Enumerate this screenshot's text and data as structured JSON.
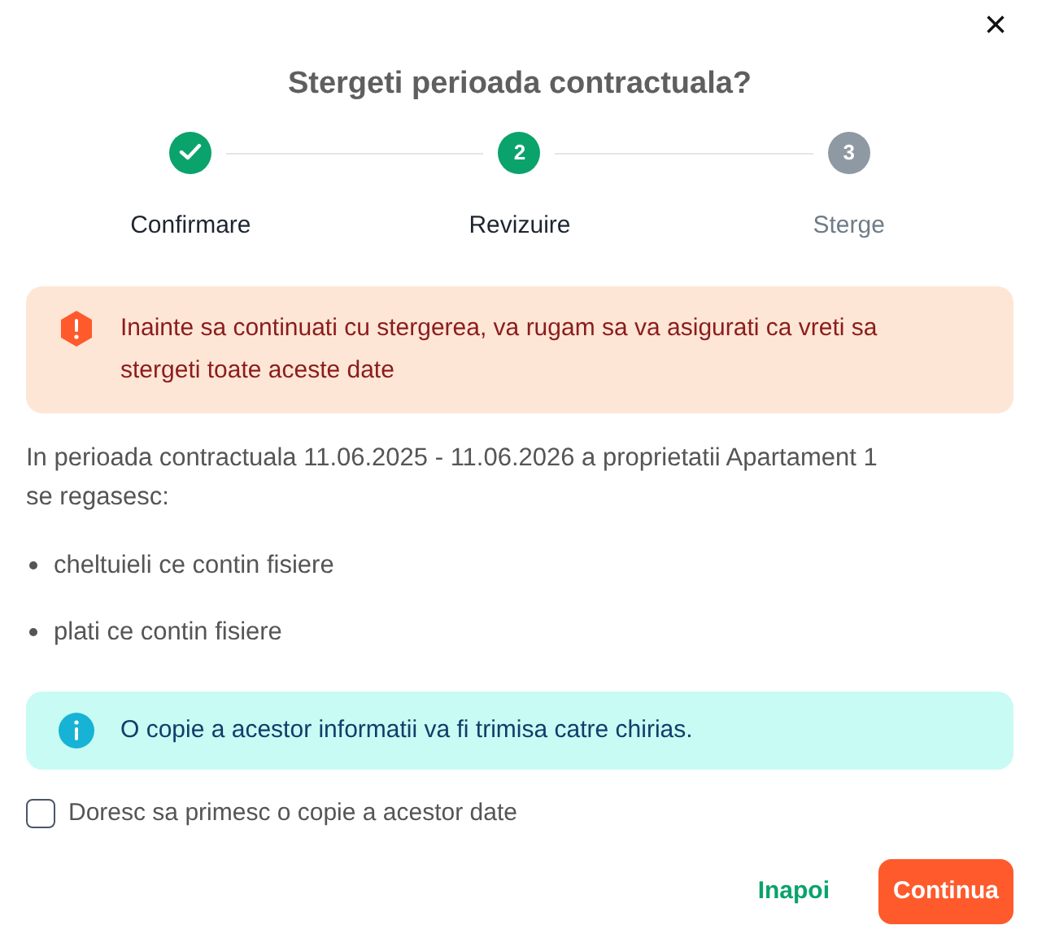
{
  "close_button": "×",
  "title": "Stergeti perioada contractuala?",
  "steps": [
    {
      "label": "Confirmare",
      "completed": true
    },
    {
      "label": "Revizuire",
      "number": "2",
      "completed": false,
      "active": true
    },
    {
      "label": "Sterge",
      "number": "3",
      "completed": false,
      "active": false
    }
  ],
  "warning_alert": {
    "text": "Inainte sa continuati cu stergerea, va rugam sa va asigurati ca vreti sa stergeti toate aceste date"
  },
  "description": "In perioada contractuala 11.06.2025 - 11.06.2026 a proprietatii Apartament 1 se regasesc:",
  "items": [
    "cheltuieli ce contin fisiere",
    "plati ce contin fisiere"
  ],
  "info_alert": {
    "text": "O copie a acestor informatii va fi trimisa catre chirias."
  },
  "checkbox": {
    "label": "Doresc sa primesc o copie a acestor date",
    "checked": false
  },
  "buttons": [
    {
      "label": "Inapoi",
      "kind": "link"
    },
    {
      "label": "Continua",
      "kind": "primary"
    }
  ]
}
